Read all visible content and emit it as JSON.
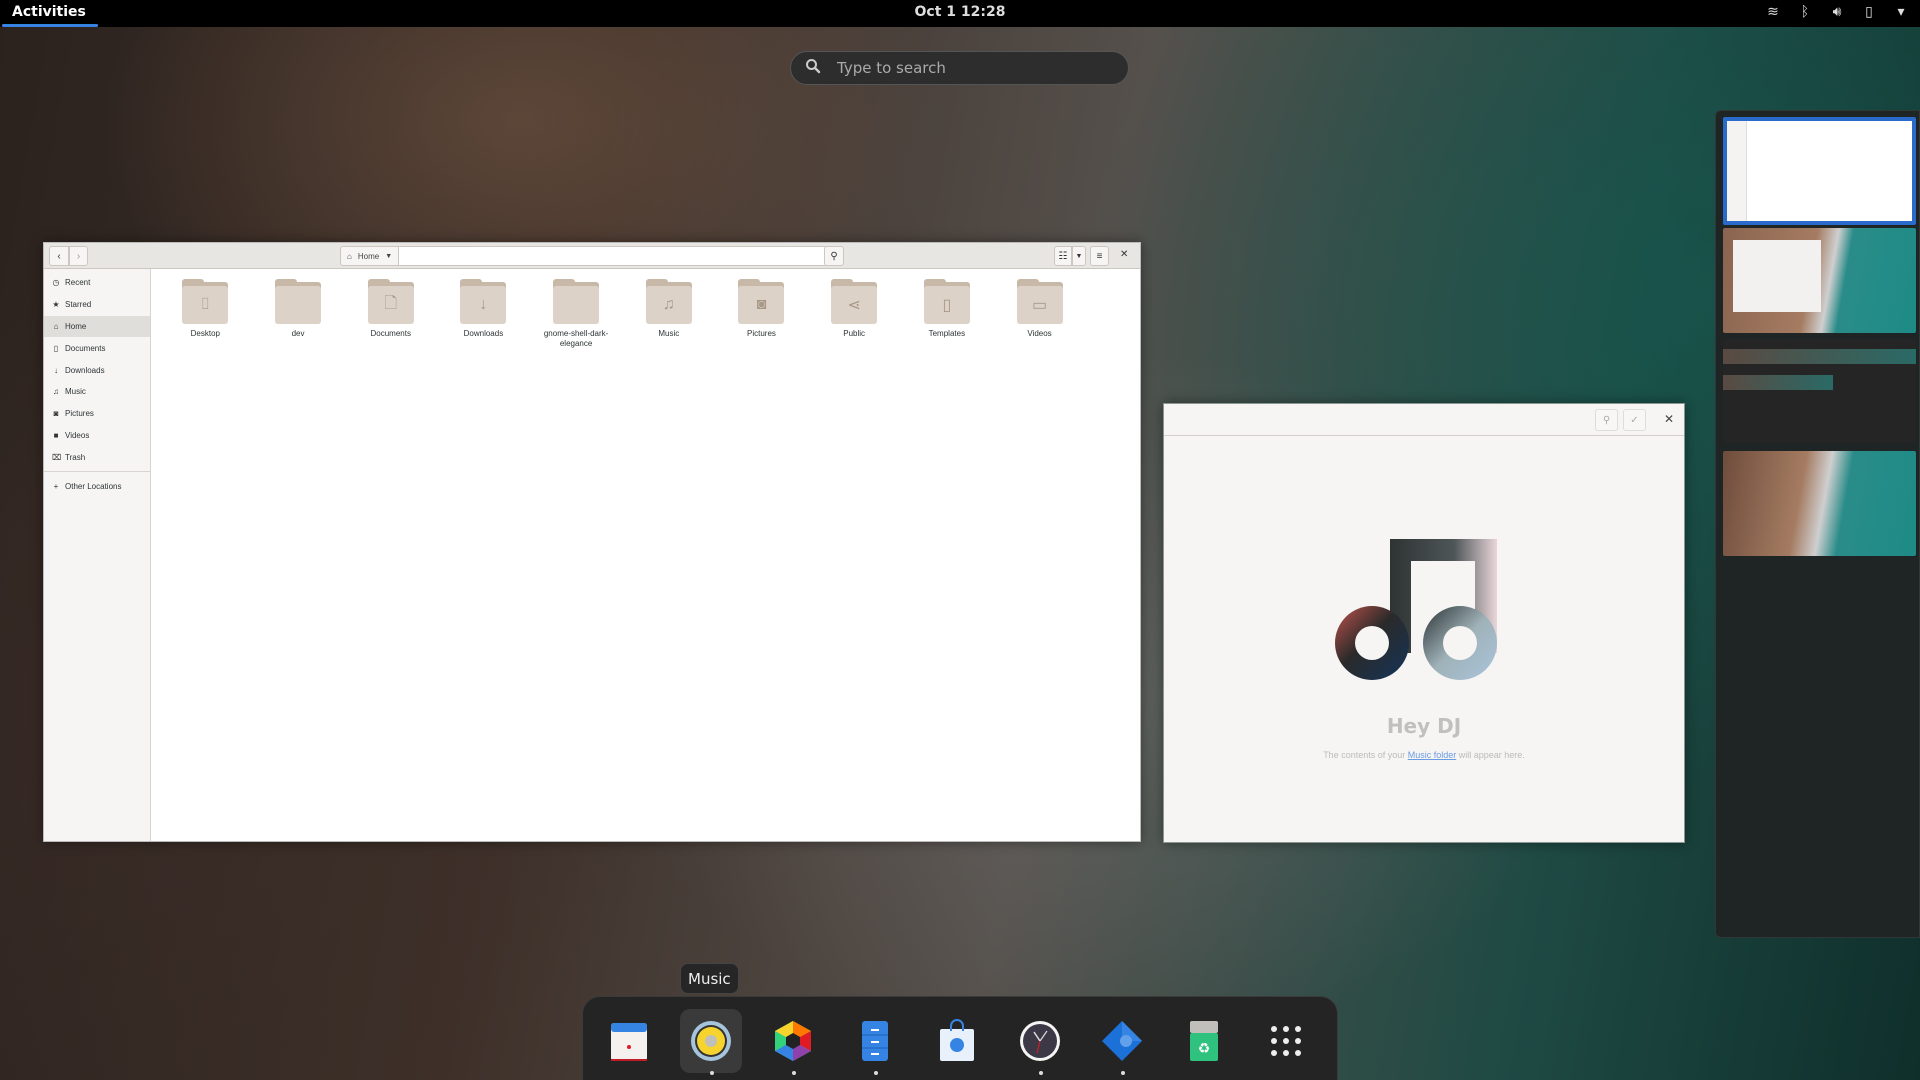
{
  "topbar": {
    "activities_label": "Activities",
    "clock": "Oct 1  12:28",
    "tray_icons": [
      "wifi-icon",
      "bluetooth-icon",
      "volume-icon",
      "battery-icon",
      "system-menu-chevron-icon"
    ]
  },
  "search": {
    "placeholder": "Type to search"
  },
  "files_window": {
    "path": {
      "current": "Home"
    },
    "sidebar": {
      "items": [
        {
          "label": "Recent",
          "icon": "clock-icon"
        },
        {
          "label": "Starred",
          "icon": "star-icon"
        },
        {
          "label": "Home",
          "icon": "home-icon",
          "active": true
        },
        {
          "label": "Documents",
          "icon": "document-icon"
        },
        {
          "label": "Downloads",
          "icon": "download-icon"
        },
        {
          "label": "Music",
          "icon": "music-icon"
        },
        {
          "label": "Pictures",
          "icon": "camera-icon"
        },
        {
          "label": "Videos",
          "icon": "video-icon"
        },
        {
          "label": "Trash",
          "icon": "trash-icon"
        }
      ],
      "other_locations": "Other Locations"
    },
    "folders": [
      {
        "label": "Desktop",
        "icon": "desktop-icon",
        "glyph": "⌷"
      },
      {
        "label": "dev",
        "icon": "folder-icon",
        "glyph": ""
      },
      {
        "label": "Documents",
        "icon": "document-icon",
        "glyph": "🗋"
      },
      {
        "label": "Downloads",
        "icon": "download-icon",
        "glyph": "↓"
      },
      {
        "label": "gnome-shell-dark-elegance",
        "icon": "folder-icon",
        "glyph": ""
      },
      {
        "label": "Music",
        "icon": "music-icon",
        "glyph": "♫"
      },
      {
        "label": "Pictures",
        "icon": "camera-icon",
        "glyph": "◙"
      },
      {
        "label": "Public",
        "icon": "share-icon",
        "glyph": "⋖"
      },
      {
        "label": "Templates",
        "icon": "template-icon",
        "glyph": "▯"
      },
      {
        "label": "Videos",
        "icon": "video-icon",
        "glyph": "▭"
      }
    ]
  },
  "music_window": {
    "title": "Hey DJ",
    "text_before": "The contents of your ",
    "link": "Music folder",
    "text_after": " will appear here."
  },
  "dock": {
    "tooltip": "Music",
    "apps": [
      {
        "name": "calendar",
        "running": false
      },
      {
        "name": "music",
        "running": true
      },
      {
        "name": "photos",
        "running": true
      },
      {
        "name": "files",
        "running": true
      },
      {
        "name": "software",
        "running": false
      },
      {
        "name": "clocks",
        "running": true
      },
      {
        "name": "builder",
        "running": true
      },
      {
        "name": "trash",
        "running": false
      },
      {
        "name": "show-apps",
        "running": false
      }
    ]
  },
  "workspaces": {
    "count": 4,
    "active": 1
  }
}
